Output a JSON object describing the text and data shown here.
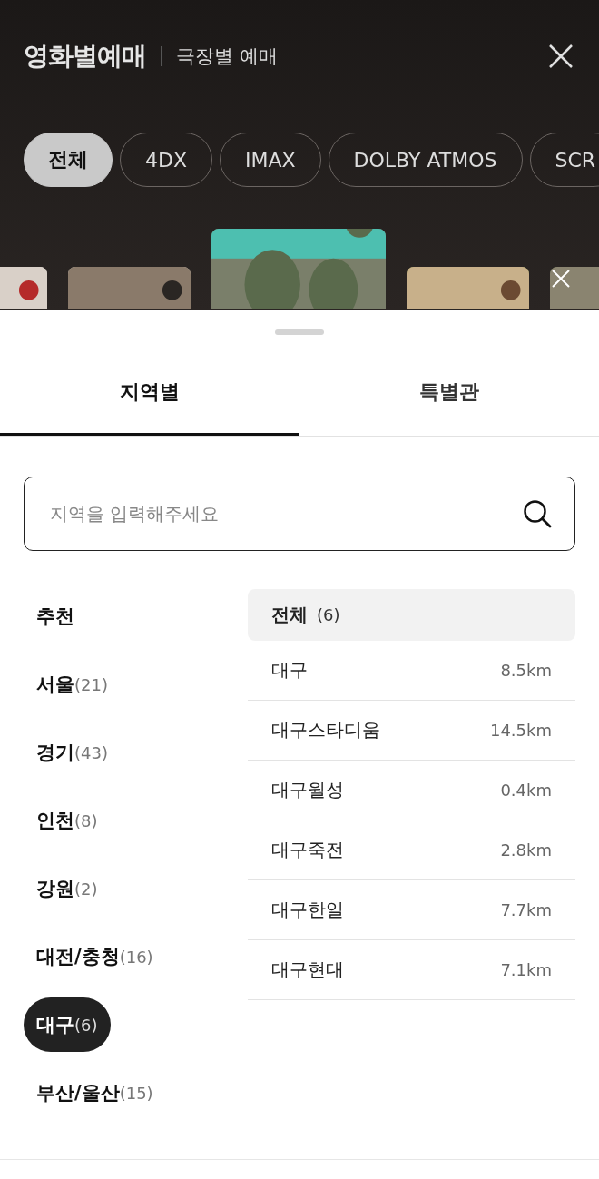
{
  "header": {
    "title": "영화별예매",
    "alt_tab": "극장별 예매"
  },
  "formats": [
    {
      "label": "전체",
      "selected": true
    },
    {
      "label": "4DX",
      "selected": false
    },
    {
      "label": "IMAX",
      "selected": false
    },
    {
      "label": "DOLBY ATMOS",
      "selected": false
    },
    {
      "label": "SCR",
      "selected": false
    }
  ],
  "posters": [
    {
      "kind": "picture",
      "selected": false
    },
    {
      "kind": "picture",
      "selected": false
    },
    {
      "kind": "picture",
      "selected": true
    },
    {
      "kind": "picture",
      "selected": false
    },
    {
      "kind": "picture",
      "selected": false
    }
  ],
  "sheet": {
    "tabs": [
      {
        "label": "지역별",
        "selected": true
      },
      {
        "label": "특별관",
        "selected": false
      }
    ],
    "search": {
      "placeholder": "지역을 입력해주세요"
    },
    "regions": [
      {
        "name": "추천",
        "selected": false
      },
      {
        "name": "서울",
        "count": "(21)",
        "selected": false
      },
      {
        "name": "경기",
        "count": "(43)",
        "selected": false
      },
      {
        "name": "인천",
        "count": "(8)",
        "selected": false
      },
      {
        "name": "강원",
        "count": "(2)",
        "selected": false
      },
      {
        "name": "대전/충청",
        "count": "(16)",
        "selected": false
      },
      {
        "name": "대구",
        "count": "(6)",
        "selected": true
      },
      {
        "name": "부산/울산",
        "count": "(15)",
        "selected": false
      }
    ],
    "theaters": [
      {
        "name": "전체",
        "count": "(6)",
        "selected": true
      },
      {
        "name": "대구",
        "distance": "8.5km",
        "selected": false
      },
      {
        "name": "대구스타디움",
        "distance": "14.5km",
        "selected": false
      },
      {
        "name": "대구월성",
        "distance": "0.4km",
        "selected": false
      },
      {
        "name": "대구죽전",
        "distance": "2.8km",
        "selected": false
      },
      {
        "name": "대구한일",
        "distance": "7.7km",
        "selected": false
      },
      {
        "name": "대구현대",
        "distance": "7.1km",
        "selected": false
      }
    ]
  }
}
